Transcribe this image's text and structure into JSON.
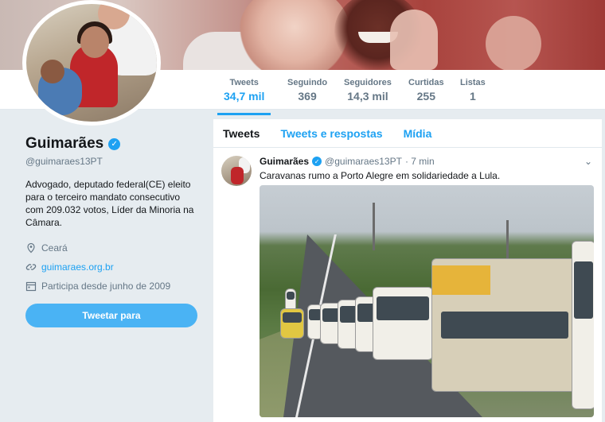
{
  "profile": {
    "name": "Guimarães",
    "handle": "@guimaraes13PT",
    "bio": "Advogado, deputado federal(CE) eleito para o terceiro mandato consecutivo com 209.032 votos, Líder da Minoria na Câmara.",
    "location": "Ceará",
    "website": "guimaraes.org.br",
    "joined": "Participa desde junho de 2009",
    "tweet_button": "Tweetar para"
  },
  "stats": [
    {
      "label": "Tweets",
      "value": "34,7 mil"
    },
    {
      "label": "Seguindo",
      "value": "369"
    },
    {
      "label": "Seguidores",
      "value": "14,3 mil"
    },
    {
      "label": "Curtidas",
      "value": "255"
    },
    {
      "label": "Listas",
      "value": "1"
    }
  ],
  "tabs": {
    "tweets": "Tweets",
    "replies": "Tweets e respostas",
    "media": "Mídia"
  },
  "tweet": {
    "name": "Guimarães",
    "handle": "@guimaraes13PT",
    "time": "· 7 min",
    "text": "Caravanas rumo a Porto Alegre em solidariedade a Lula."
  },
  "colors": {
    "accent": "#1da1f2",
    "button": "#4ab3f4",
    "background": "#e6ecf0"
  }
}
